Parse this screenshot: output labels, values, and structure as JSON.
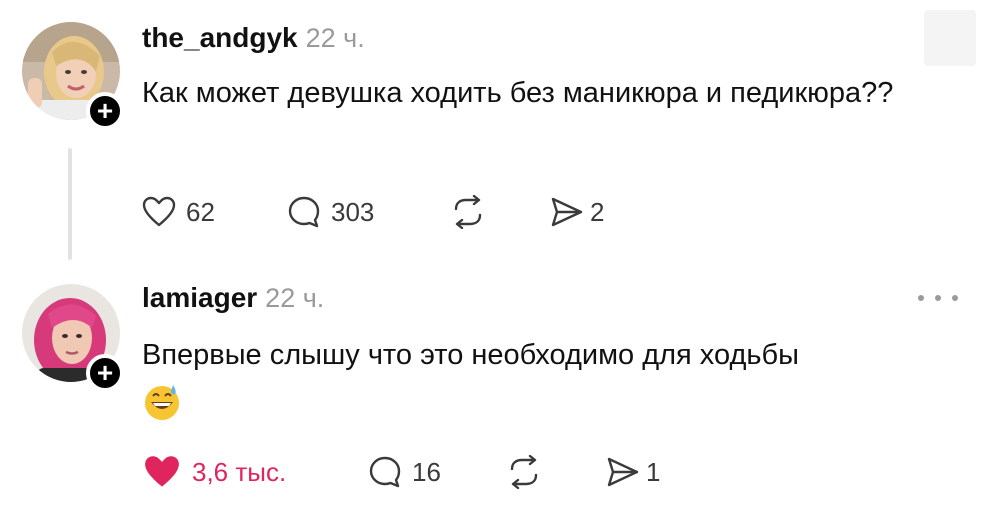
{
  "posts": [
    {
      "username": "the_andgyk",
      "time": "22 ч.",
      "text": "Как может девушка ходить без маникюра и педикюра??",
      "likes": "62",
      "comments": "303",
      "shares": "2",
      "liked": false,
      "avatar_icon": "profile-photo-blonde",
      "follow_symbol": "+"
    },
    {
      "username": "lamiager",
      "time": "22 ч.",
      "text": "Впервые слышу что это необходимо для ходьбы",
      "emoji": "grinning-sweat-emoji",
      "likes": "3,6 тыс.",
      "comments": "16",
      "shares": "1",
      "liked": true,
      "avatar_icon": "profile-photo-pink-hair",
      "follow_symbol": "+"
    }
  ],
  "colors": {
    "like_active": "#e0245e",
    "muted_text": "#9a9a9a",
    "icon_stroke": "#3a3a3a"
  }
}
